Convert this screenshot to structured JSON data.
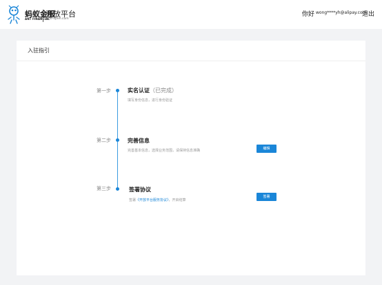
{
  "header": {
    "brand_cn": "蚂蚁金服",
    "brand_en": "ANT FINANCIAL",
    "platform_cn": "开放平台",
    "platform_en": "antl-open.com",
    "greeting": "你好",
    "email": "wong****yh@alipay.com",
    "logout": "退出"
  },
  "card": {
    "title": "入驻指引"
  },
  "steps": [
    {
      "label": "第一步",
      "title": "实名认证",
      "status": "（已完成）",
      "desc": "填写身份信息，进行身份验证"
    },
    {
      "label": "第二步",
      "title": "完善信息",
      "desc": "完善基本信息，选择业务范围，请保持信息准确",
      "button": "编辑"
    },
    {
      "label": "第三步",
      "title": "签署协议",
      "desc_prefix": "签署",
      "desc_link": "《开放平台服务协议》",
      "desc_suffix": "，开启结算",
      "button": "签署"
    }
  ],
  "colors": {
    "accent": "#1a86d8",
    "background": "#f2f3f5"
  }
}
